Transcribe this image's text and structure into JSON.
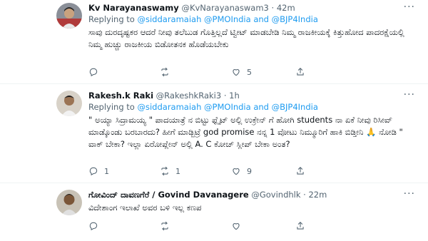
{
  "tweets": [
    {
      "name": "Kv Narayanaswamy",
      "handle": "@KvNarayanaswam3",
      "sep": "·",
      "time": "42m",
      "replying": "Replying to",
      "mentions": "@siddaramaiah @PMOIndia and @BJP4India",
      "text": "ಸಾವು ದುರದೃಷ್ಟಕರ ಆದರೆ ನೀವು ತಲೆಬುಡ ಗೊತ್ತಿಲ್ಲದೆ ಟ್ವೀಟ್ ಮಾಡಬೇಡಿ ನಿಮ್ಮ ರಾಜಕೀಯಕ್ಕೆ ಕಿತ್ತುಹೋದ ಪಾದರಕ್ಷೆಯಲ್ಲಿ ನಿಮ್ಮ ಹುಚ್ಚು ರಾಜಕೀಯ ಬಿಡೋತನಕ ಹೊಡೆಯಬೇಕು",
      "replies": "",
      "retweets": "",
      "likes": "5"
    },
    {
      "name": "Rakesh.k Raki",
      "handle": "@RakeshkRaki3",
      "sep": "·",
      "time": "1h",
      "replying": "Replying to",
      "mentions": "@siddaramaiah @PMOIndia and @BJP4India",
      "text": "\" ಅಯ್ಯಾ ಸಿದ್ರಾಮಯ್ಯ \" ಪಾದಯಾತ್ರೆ ನ ಬಿಟ್ಟು ಫ್ಲೈಟ್ ಅಲ್ಲಿ ಉಕ್ರೇನ್ ಗೆ ಹೋಗಿ students ನಾ ಏಕೆ ನೀವು ರಿಸೀವ್ ಮಾಡ್ಕೊಂಡು ಬರಬಾರದು? ಹೀಗೆ ಮಾಡ್ಬಿಟ್ರೆ god promise ನನ್ನ 1 ವೋಟು ನಿಮ್ಮೂರಿಗೆ ಹಾಕಿ ಬಿಡ್ತೀನಿ 🙏 ನೋಡಿ \" ವಾಕ್ ಬೇಕಾ? ಇಲ್ಲಾ ಏರೋಪ್ಲೇನ್ ಅಲ್ಲಿ A. C ಕೋಚ್ ಸ್ಲೀಪ್ ಬೇಕಾ ಅಂತ?",
      "replies": "1",
      "retweets": "1",
      "likes": "9"
    },
    {
      "name": "ಗೋವಿಂದ್ ದಾವಣಗೆರೆ / Govind Davanagere",
      "handle": "@Govindhlk",
      "sep": "·",
      "time": "22m",
      "replying": "",
      "mentions": "",
      "text": "ವಿದೇಶಾಂಗ ಇಲಾಖೆ ಅವರ ಬಳಿ ಇಲ್ಲ ಕಣಪ",
      "replies": "",
      "retweets": "",
      "likes": ""
    }
  ],
  "more_glyph": "···",
  "colors": {
    "link": "#1d9bf0",
    "muted": "#536471",
    "text": "#0f1419",
    "divider": "#eff3f4"
  }
}
